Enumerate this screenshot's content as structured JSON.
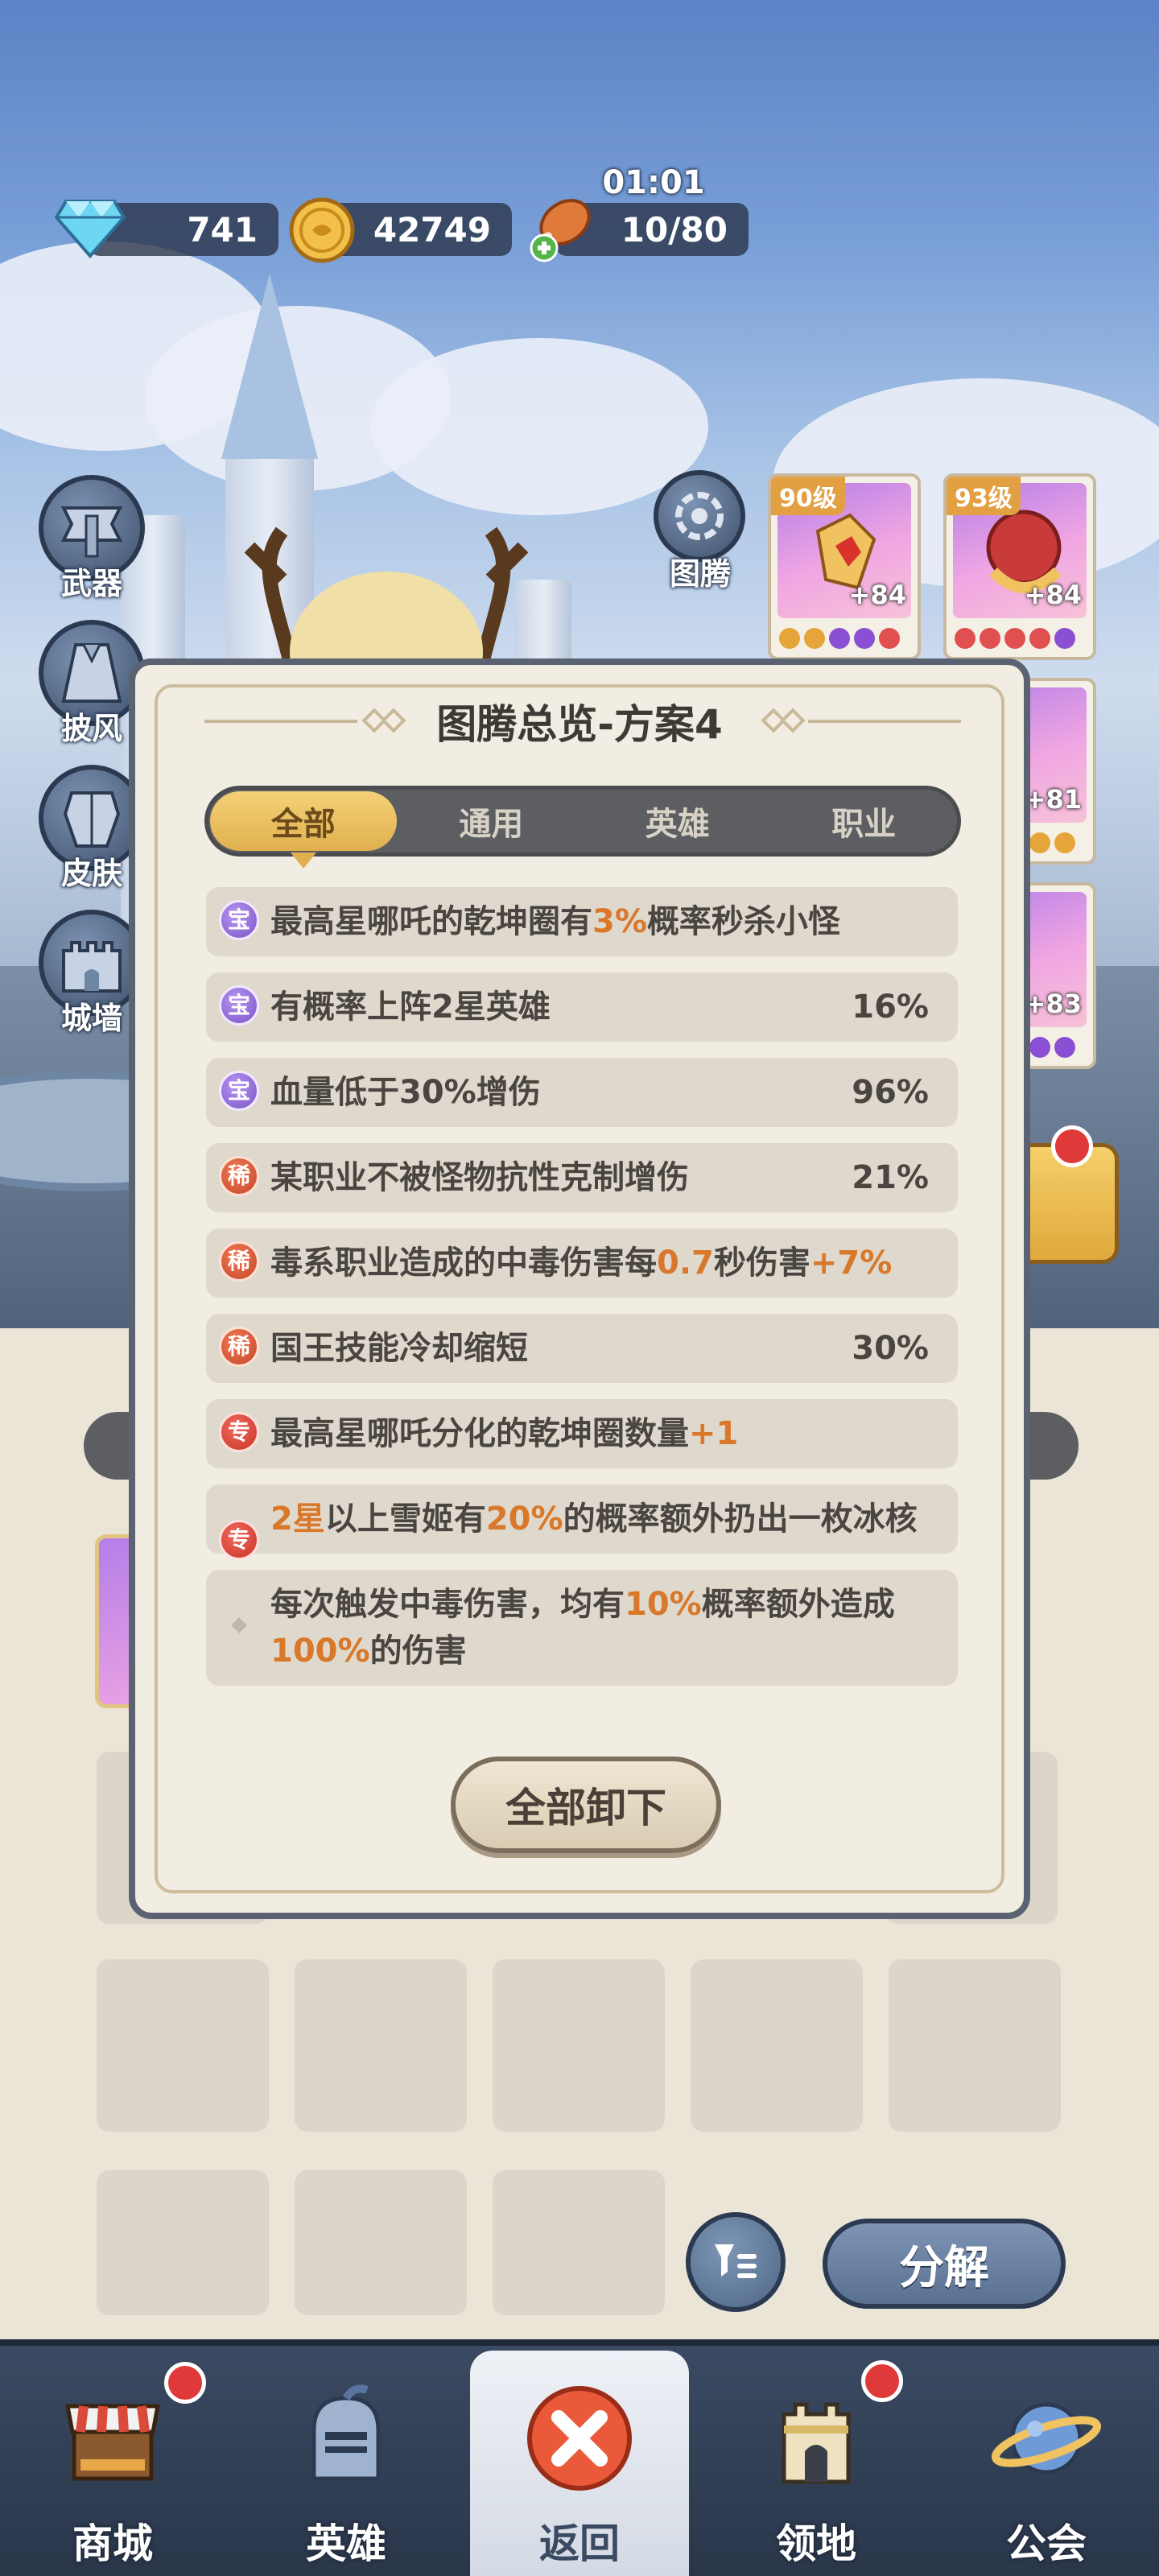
{
  "resources": {
    "diamonds": "741",
    "gold": "42749",
    "stamina": "10/80",
    "stamina_timer": "01:01"
  },
  "side_menu": [
    {
      "label": "武器",
      "icon": "weapon-icon"
    },
    {
      "label": "披风",
      "icon": "cape-icon"
    },
    {
      "label": "皮肤",
      "icon": "skin-icon"
    },
    {
      "label": "城墙",
      "icon": "wall-icon"
    }
  ],
  "totem_button": {
    "label": "图腾",
    "icon": "totem-gear-icon"
  },
  "totem_cards": [
    {
      "level": "90级",
      "plus": "+84"
    },
    {
      "level": "93级",
      "plus": "+84"
    },
    {
      "plus": "+81"
    },
    {
      "plus": "+83"
    }
  ],
  "modal": {
    "title": "图腾总览-方案4",
    "tabs": [
      "全部",
      "通用",
      "英雄",
      "职业"
    ],
    "active_tab": "全部",
    "effects": [
      {
        "badge": "宝",
        "type": "bao",
        "parts": [
          "最高星哪吒的乾坤圈有",
          "3%",
          "概率秒杀小怪"
        ],
        "value": ""
      },
      {
        "badge": "宝",
        "type": "bao",
        "parts": [
          "有概率上阵2星英雄",
          "",
          ""
        ],
        "value": "16%"
      },
      {
        "badge": "宝",
        "type": "bao",
        "parts": [
          "血量低于30%增伤",
          "",
          ""
        ],
        "value": "96%"
      },
      {
        "badge": "稀",
        "type": "xi",
        "parts": [
          "某职业不被怪物抗性克制增伤",
          "",
          ""
        ],
        "value": "21%"
      },
      {
        "badge": "稀",
        "type": "xi",
        "parts": [
          "毒系职业造成的中毒伤害每",
          "0.7",
          "秒伤害",
          "+7%"
        ],
        "value": ""
      },
      {
        "badge": "稀",
        "type": "xi",
        "parts": [
          "国王技能冷却缩短",
          "",
          ""
        ],
        "value": "30%"
      },
      {
        "badge": "专",
        "type": "zhuan",
        "parts": [
          "最高星哪吒分化的乾坤圈数量",
          "+1",
          ""
        ],
        "value": ""
      },
      {
        "badge": "专",
        "type": "zhuan",
        "parts": [
          "2星",
          "以上雪姬有",
          "20%",
          "的概率额外扔出一枚冰核"
        ],
        "value": ""
      },
      {
        "badge": "",
        "type": "dot",
        "parts": [
          "每次触发中毒伤害，均有",
          "10%",
          "概率额外造成",
          "100%",
          "的伤害"
        ],
        "value": ""
      }
    ],
    "unload_all_label": "全部卸下"
  },
  "bottom_actions": {
    "filter_icon": "filter-list-icon",
    "decompose_label": "分解"
  },
  "bottom_nav": [
    {
      "label": "商城",
      "icon": "shop-stall-icon",
      "badge": true
    },
    {
      "label": "英雄",
      "icon": "knight-helmet-icon",
      "badge": false
    },
    {
      "label": "返回",
      "icon": "close-x-icon",
      "badge": false,
      "active": true
    },
    {
      "label": "领地",
      "icon": "castle-tower-icon",
      "badge": true
    },
    {
      "label": "公会",
      "icon": "planet-icon",
      "badge": false
    }
  ],
  "colors": {
    "highlight": "#d9782b",
    "tab_active": "#e0b04f",
    "panel": "#f1ede2",
    "nav": "#3a4a62",
    "badge_red": "#e0393a"
  }
}
